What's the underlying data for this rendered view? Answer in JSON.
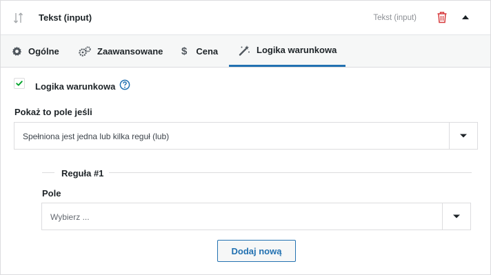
{
  "header": {
    "title": "Tekst (input)",
    "type_label": "Tekst (input)",
    "sort_icon": "sort-arrows-icon",
    "delete_icon": "trash-icon",
    "collapse_icon": "caret-up-icon",
    "delete_color": "#d63638"
  },
  "tabs": [
    {
      "label": "Ogólne",
      "icon": "gear-icon",
      "active": false
    },
    {
      "label": "Zaawansowane",
      "icon": "gears-icon",
      "active": false
    },
    {
      "label": "Cena",
      "icon": "dollar-icon",
      "active": false
    },
    {
      "label": "Logika warunkowa",
      "icon": "magic-wand-icon",
      "active": true
    }
  ],
  "conditional": {
    "checkbox_label": "Logika warunkowa",
    "checked": true,
    "help_icon": "question-circle-icon",
    "show_if_label": "Pokaż to pole jeśli",
    "show_if_value": "Spełniona jest jedna lub kilka reguł (lub)"
  },
  "rule": {
    "title": "Reguła #1",
    "field_label": "Pole",
    "field_placeholder": "Wybierz ..."
  },
  "add_button_label": "Dodaj nową",
  "colors": {
    "accent": "#2271b1",
    "check": "#00a32a",
    "danger": "#d63638"
  }
}
